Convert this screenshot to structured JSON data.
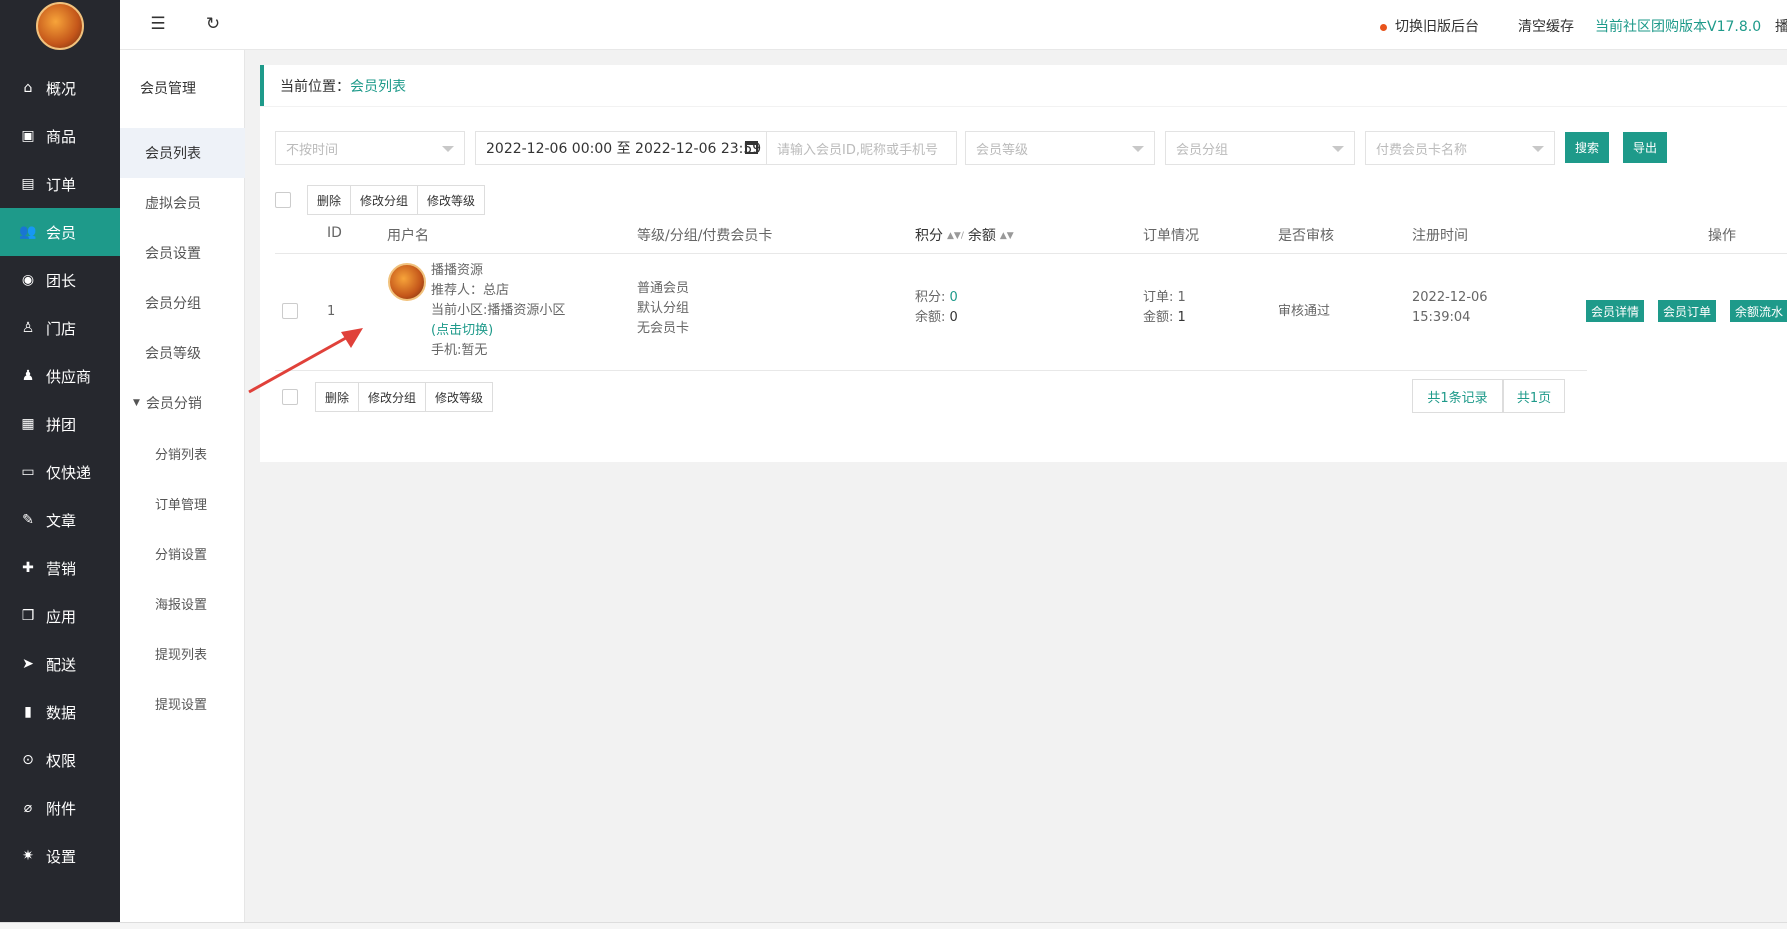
{
  "topbar": {
    "switch_old": "切换旧版后台",
    "clear_cache": "清空缓存",
    "version": "当前社区团购版本V17.8.0",
    "more": "播"
  },
  "sidebar": {
    "items": [
      {
        "label": "概况",
        "icon": "home-icon"
      },
      {
        "label": "商品",
        "icon": "goods-icon"
      },
      {
        "label": "订单",
        "icon": "order-icon"
      },
      {
        "label": "会员",
        "icon": "member-icon"
      },
      {
        "label": "团长",
        "icon": "leader-icon"
      },
      {
        "label": "门店",
        "icon": "store-icon"
      },
      {
        "label": "供应商",
        "icon": "supplier-icon"
      },
      {
        "label": "拼团",
        "icon": "groupbuy-icon"
      },
      {
        "label": "仅快递",
        "icon": "express-icon"
      },
      {
        "label": "文章",
        "icon": "article-icon"
      },
      {
        "label": "营销",
        "icon": "gift-icon"
      },
      {
        "label": "应用",
        "icon": "app-icon"
      },
      {
        "label": "配送",
        "icon": "truck-icon"
      },
      {
        "label": "数据",
        "icon": "chart-icon"
      },
      {
        "label": "权限",
        "icon": "lock-icon"
      },
      {
        "label": "附件",
        "icon": "attachment-icon"
      },
      {
        "label": "设置",
        "icon": "gear-icon"
      }
    ]
  },
  "submenu": {
    "title": "会员管理",
    "items": [
      "会员列表",
      "虚拟会员",
      "会员设置",
      "会员分组",
      "会员等级"
    ],
    "group": "会员分销",
    "children": [
      "分销列表",
      "订单管理",
      "分销设置",
      "海报设置",
      "提现列表",
      "提现设置"
    ]
  },
  "breadcrumb": {
    "prefix": "当前位置：",
    "current": "会员列表"
  },
  "filters": {
    "time_select": "不按时间",
    "date_range": "2022-12-06 00:00 至 2022-12-06 23:59",
    "keyword_placeholder": "请输入会员ID,昵称或手机号",
    "level": "会员等级",
    "group": "会员分组",
    "card": "付费会员卡名称",
    "search_btn": "搜索",
    "export_btn": "导出"
  },
  "actions": {
    "delete": "删除",
    "change_group": "修改分组",
    "change_level": "修改等级"
  },
  "table": {
    "headers": {
      "id": "ID",
      "username": "用户名",
      "level_group_card": "等级/分组/付费会员卡",
      "points": "积分",
      "balance": "余额",
      "orders": "订单情况",
      "audit": "是否审核",
      "reg_time": "注册时间",
      "ops": "操作"
    },
    "rows": [
      {
        "id": "1",
        "name": "播播资源",
        "referrer": "推荐人：总店",
        "community": "当前小区:播播资源小区",
        "switch": "(点击切换)",
        "phone": "手机:暂无",
        "level": "普通会员",
        "group": "默认分组",
        "card": "无会员卡",
        "points_label": "积分:",
        "points": "0",
        "balance_label": "余额:",
        "balance": "0",
        "order_label": "订单:",
        "order_count": "1",
        "amount_label": "金额:",
        "amount": "1",
        "audit": "审核通过",
        "reg_date": "2022-12-06",
        "reg_time": "15:39:04",
        "ops": [
          "会员详情",
          "会员订单",
          "余额流水"
        ]
      }
    ]
  },
  "pager": {
    "total_records": "共1条记录",
    "total_pages": "共1页"
  }
}
